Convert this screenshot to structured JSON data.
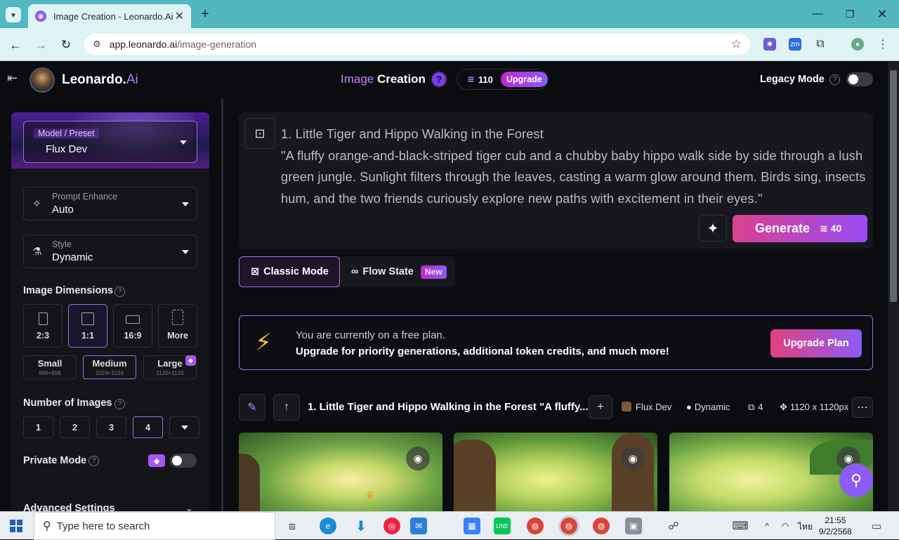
{
  "browser": {
    "tab_title": "Image Creation - Leonardo.Ai",
    "url_host": "app.leonardo.ai",
    "url_path": "/image-generation"
  },
  "header": {
    "brand_name": "Leonardo.",
    "brand_suffix": "Ai",
    "title_a": "Image",
    "title_b": "Creation",
    "help_label": "?",
    "token_count": "110",
    "upgrade_label": "Upgrade",
    "legacy_label": "Legacy Mode"
  },
  "sidebar": {
    "model_label": "Model / Preset",
    "model_value": "Flux Dev",
    "prompt_enhance_label": "Prompt Enhance",
    "prompt_enhance_value": "Auto",
    "style_label": "Style",
    "style_value": "Dynamic",
    "dimensions_title": "Image Dimensions",
    "ratios": [
      "2:3",
      "1:1",
      "16:9",
      "More"
    ],
    "selected_ratio": "1:1",
    "sizes": [
      {
        "label": "Small",
        "px": "896×896"
      },
      {
        "label": "Medium",
        "px": "1024×1024"
      },
      {
        "label": "Large",
        "px": "1120×1120"
      }
    ],
    "selected_size": "Medium",
    "num_images_title": "Number of Images",
    "num_options": [
      "1",
      "2",
      "3",
      "4"
    ],
    "selected_num": "4",
    "private_mode_label": "Private Mode",
    "advanced_label": "Advanced Settings"
  },
  "prompt": {
    "text": "1. Little Tiger and Hippo Walking in the Forest\n\"A fluffy orange-and-black-striped tiger cub and a chubby baby hippo walk side by side through a lush green jungle. Sunlight filters through the leaves, casting a warm glow around them. Birds sing, insects hum, and the two friends curiously explore new paths with excitement in their eyes.\"",
    "generate_label": "Generate",
    "generate_cost": "40"
  },
  "modes": {
    "classic": "Classic Mode",
    "flow": "Flow State",
    "flow_badge": "New"
  },
  "banner": {
    "line1": "You are currently on a free plan.",
    "line2": "Upgrade for priority generations, additional token credits, and much more!",
    "button": "Upgrade Plan"
  },
  "generation": {
    "title": "1. Little Tiger and Hippo Walking in the Forest \"A fluffy...",
    "model": "Flux Dev",
    "style": "Dynamic",
    "count": "4",
    "resolution": "1120 x 1120px"
  },
  "taskbar": {
    "search_placeholder": "Type here to search",
    "time": "21:55",
    "date": "9/2/2568",
    "lang": "ไทย"
  }
}
